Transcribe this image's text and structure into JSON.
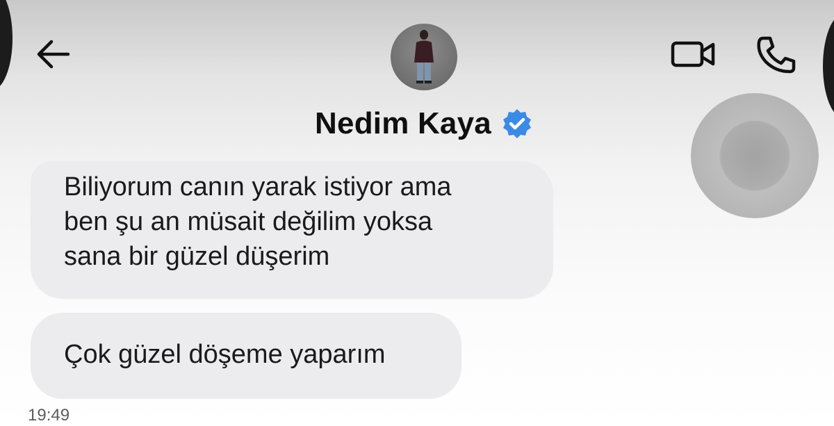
{
  "header": {
    "back_icon": "arrow-left-icon",
    "contact_name": "Nedim Kaya",
    "verified_icon": "verified-badge-icon",
    "verified_color": "#3b8ae6",
    "video_call_icon": "video-camera-icon",
    "voice_call_icon": "phone-icon"
  },
  "messages": [
    {
      "lines": [
        "Biliyorum canın yarak istiyor ama",
        "ben şu an müsait değilim yoksa",
        "sana bir güzel düşerim"
      ]
    },
    {
      "lines": [
        "Çok güzel döşeme yaparım"
      ]
    }
  ],
  "timestamp": "19:49",
  "colors": {
    "bubble_background": "#ececee",
    "text": "#1a1a1a",
    "timestamp": "#5d5d5d"
  }
}
